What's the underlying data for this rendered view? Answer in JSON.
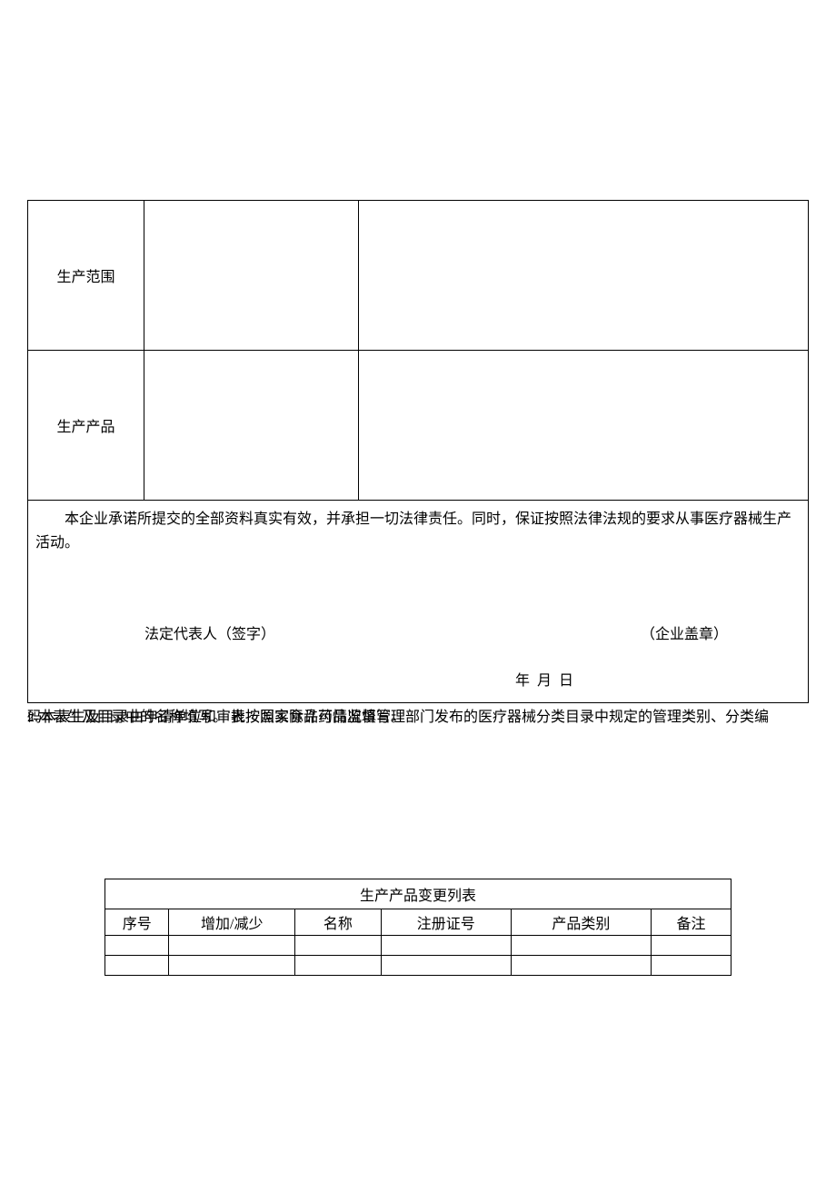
{
  "mainTable": {
    "row1Label": "生产范围",
    "row2Label": "生产产品"
  },
  "declaration": {
    "text": "本企业承诺所提交的全部资料真实有效，并承担一切法律责任。同时，保证按照法律法规的要求从事医疗器械生产活动。",
    "signerLabel": "法定代表人（签字）",
    "sealLabel": "（企业盖章）",
    "dateLabel": "年        月        日"
  },
  "notes": {
    "line1": "2.本表生及目录中的名称填写。 表按照实际许可情况填写。",
    "line2": "码本表生及目录由申请单位和审批按国家食品药品监督管理部门发布的医疗器械分类目录中规定的管理类别、分类编"
  },
  "changeTable": {
    "title": "生产产品变更列表",
    "headers": {
      "seq": "序号",
      "addrem": "增加/减少",
      "name": "名称",
      "regno": "注册证号",
      "category": "产品类别",
      "remark": "备注"
    }
  }
}
